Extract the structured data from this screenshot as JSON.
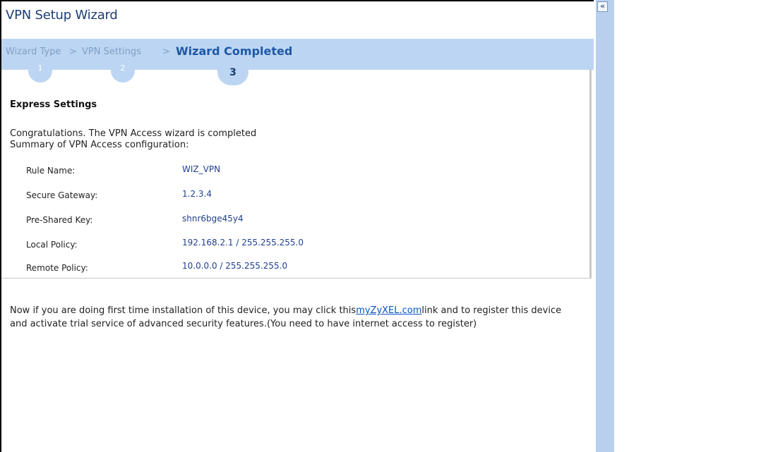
{
  "wizard": {
    "title": "VPN Setup Wizard",
    "steps": [
      {
        "name": "Wizard Type",
        "number": "1"
      },
      {
        "name": "VPN Settings",
        "number": "2"
      },
      {
        "name": "Wizard Completed",
        "number": "3"
      }
    ],
    "separator": ">"
  },
  "express": {
    "heading": "Express Settings",
    "congrats_line1": "Congratulations. The VPN Access wizard is completed",
    "congrats_line2": "Summary of VPN Access configuration:",
    "rows": [
      {
        "label": "Rule Name:",
        "value": "WIZ_VPN"
      },
      {
        "label": "Secure Gateway:",
        "value": "1.2.3.4"
      },
      {
        "label": "Pre-Shared Key:",
        "value": "shnr6bge45y4"
      },
      {
        "label": "Local Policy:",
        "value": "192.168.2.1 / 255.255.255.0"
      },
      {
        "label": "Remote Policy:",
        "value": "10.0.0.0 / 255.255.255.0"
      }
    ]
  },
  "note": {
    "prefix": "Now if you are doing first time installation of this device, you may click this",
    "link": "myZyXEL.com",
    "suffix": "link and to register this device and activate trial service of advanced security features.(You need to have internet access to register)"
  },
  "sidebar": {
    "collapse_label": "«"
  },
  "colors": {
    "accent": "#1f57a6",
    "step_bar": "#bcd5f2",
    "sidebar": "#b8d0ee"
  }
}
